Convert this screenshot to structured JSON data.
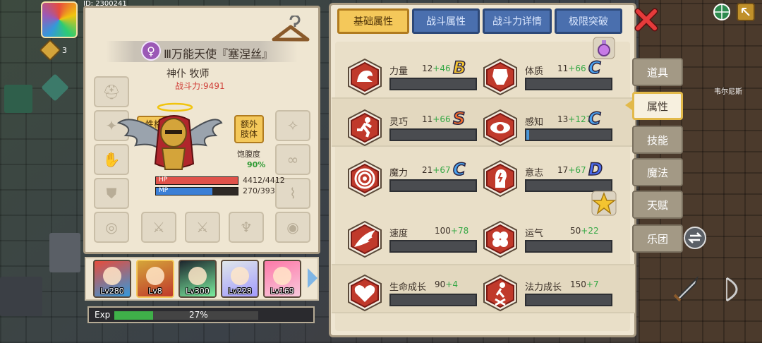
{
  "hud": {
    "player_id": "ID: 2300241",
    "coin_count": "3"
  },
  "character": {
    "name": "万能天使『塞涅丝』",
    "name_prefix": "Ⅲ",
    "gender_icon": "female-icon",
    "class_line": "神仆 牧师",
    "power_text": "战斗力:9491",
    "tag_personality": "性格",
    "tag_extra_limb": "额外肢体",
    "satiety_label": "饱腹度",
    "satiety_value": "90%",
    "hp_label": "HP",
    "hp_value": "4412/4412",
    "hp_fraction": 1.0,
    "mp_label": "MP",
    "mp_value": "270/393",
    "mp_fraction": 0.69
  },
  "roster": [
    {
      "level": "Lv280",
      "colors": [
        "#e74c3c",
        "#3498db"
      ]
    },
    {
      "level": "Lv8",
      "colors": [
        "#d4a43a",
        "#c0392b"
      ]
    },
    {
      "level": "Lv300",
      "colors": [
        "#1e272e",
        "#7bed9f"
      ]
    },
    {
      "level": "Lv228",
      "colors": [
        "#dfe6e9",
        "#a29bfe"
      ]
    },
    {
      "level": "Lv169",
      "colors": [
        "#fd79a8",
        "#f8c8dc"
      ]
    }
  ],
  "exp": {
    "label": "Exp",
    "percent_text": "27%",
    "fraction": 0.27
  },
  "tabs": [
    {
      "label": "基础属性",
      "active": true
    },
    {
      "label": "战斗属性",
      "active": false
    },
    {
      "label": "战斗力详情",
      "active": false
    },
    {
      "label": "极限突破",
      "active": false
    }
  ],
  "stats": [
    {
      "name": "力量",
      "base": "12",
      "bonus": "+46",
      "grade": "B",
      "grade_color": "#f4c430",
      "bar": 0.0,
      "icon": "arm-muscle-icon"
    },
    {
      "name": "体质",
      "base": "11",
      "bonus": "+66",
      "grade": "C",
      "grade_color": "#4aa3f0",
      "bar": 0.0,
      "icon": "body-torso-icon"
    },
    {
      "name": "灵巧",
      "base": "11",
      "bonus": "+66",
      "grade": "S",
      "grade_color": "#f06a2a",
      "bar": 0.0,
      "icon": "running-man-icon"
    },
    {
      "name": "感知",
      "base": "13",
      "bonus": "+127",
      "grade": "C",
      "grade_color": "#4aa3f0",
      "bar": 0.03,
      "icon": "eye-icon"
    },
    {
      "name": "魔力",
      "base": "21",
      "bonus": "+67",
      "grade": "C",
      "grade_color": "#4aa3f0",
      "bar": 0.0,
      "icon": "magic-swirl-icon"
    },
    {
      "name": "意志",
      "base": "17",
      "bonus": "+67",
      "grade": "D",
      "grade_color": "#4a6cf0",
      "bar": 0.0,
      "icon": "will-head-icon"
    },
    {
      "name": "速度",
      "base": "100",
      "bonus": "+78",
      "grade": "",
      "grade_color": "",
      "bar": 0.0,
      "icon": "speed-wing-icon"
    },
    {
      "name": "运气",
      "base": "50",
      "bonus": "+22",
      "grade": "",
      "grade_color": "",
      "bar": 0.0,
      "icon": "clover-icon"
    },
    {
      "name": "生命成长",
      "base": "90",
      "bonus": "+4",
      "grade": "",
      "grade_color": "",
      "bar": 0.0,
      "icon": "heart-growth-icon"
    },
    {
      "name": "法力成长",
      "base": "150",
      "bonus": "+7",
      "grade": "",
      "grade_color": "",
      "bar": 0.0,
      "icon": "mana-growth-icon"
    }
  ],
  "side_tabs": [
    {
      "label": "道具",
      "active": false
    },
    {
      "label": "属性",
      "active": true
    },
    {
      "label": "技能",
      "active": false
    },
    {
      "label": "魔法",
      "active": false
    },
    {
      "label": "天赋",
      "active": false
    },
    {
      "label": "乐团",
      "active": false
    }
  ],
  "map": {
    "location_label": "韦尔尼斯"
  },
  "colors": {
    "accent_gold": "#f4c85a",
    "tab_blue": "#4a6fae",
    "stat_red": "#c0392b",
    "bonus_green": "#35a845",
    "power_red": "#d0413a"
  }
}
